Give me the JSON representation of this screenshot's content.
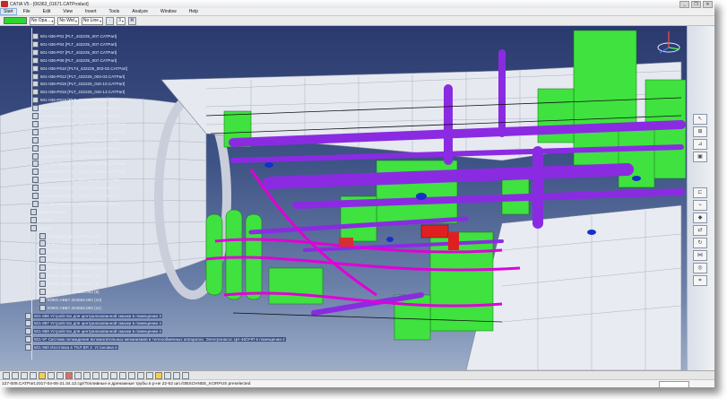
{
  "window": {
    "title": "CATIA V5 - [06363_01671.CATProduct]"
  },
  "window_buttons": [
    "_",
    "❐",
    "✕"
  ],
  "menu": {
    "items": [
      "Start",
      "File",
      "Edit",
      "View",
      "Insert",
      "Tools",
      "Analyze",
      "Window",
      "Help"
    ]
  },
  "toolbar": {
    "combo1": "No Opa...",
    "combo2": "No Wid",
    "combo3": "No Line",
    "combo4": "3",
    "arrow": "▾"
  },
  "tree": {
    "items": [
      "501-036-P01 [PLT_432225_007.CATPart]",
      "501-036-P04 [PLT_432225_007.CATPart]",
      "501-036-P07 [PLT_432225_007.CATPart]",
      "501-036-P09 [PLT_432225_007.CATPart]",
      "501-036-P010 [PLT4_432225_003-02.CATPart]",
      "501-036-P012 [PLT_432225_003-03.CATPart]",
      "501-036-P015 [PLT_432225_016-10.CATPart]",
      "501-036-P016 [PLT_432225_016-13.CATPart]",
      "501-036-P018 [PLT_432225_016.CATPart]",
      "501-036-P019 [PLT_432225_016.CATPart]",
      "501-036-P020 [PLT_432225_016.CATPart]",
      "501-036-P021 [PLT_432225_003-03.CATPart]",
      "501-036-P022 [PLT_432225_003-03.CATPart]",
      "501-036-P023 [PLT_432225_016.CATPart]",
      "501-036-P024 [PLT_432225_016.CATPart]",
      "501-036-P025 [PLT_432225_016.CATPart]",
      "501-036-P026 [PLT_432225_003-03.CATPart]",
      "501-036-P027 [PLT_432225_003-03.CATPart]",
      "501-036-P028 [PLT_432225_016.CATPart]",
      "501-036-P029 [PLT_432225_016.CATPart]",
      "501-036-P030 [PLT_432225_016.CATPart]",
      "501-036-P031 [PLT_432225_016.CATPart]",
      "Документация",
      "Views",
      "Notes",
      "Спецификация 501-959 (2)",
      "ЮЖО.АВБ7.348035.081 (3)",
      "ЮЖО.АВБ7.348035.081 ПЭ (4)",
      "ЮЖО.АВБ7.348035.081 СБ (5)",
      "ЮЖО.АВБ7.348035.081 МЧ (6)",
      "ЮЖО.АВБ7.348035.081 (7)",
      "ЮЖО.АВБ7.342554.092 (8)",
      "ЮЖО.АВБ7.342554.092 (9)",
      "ЮЖО.АВБ7.342554.092 (10)",
      "ЮЖО.АВБ7.342554.092 (11)",
      "501-896 Устройство для централизованной смазки в помещении 3",
      "501-897 Устройство для централизованной смазки в помещении 4",
      "501-959 Устройство для централизованной смазки в помещении 4",
      "501-97 Система охлаждения вспомогательных механизмов в теплообменных аппаратах. Электронасос ЦН-46/3ЧП в помещении 4",
      "501-960 Изготовка в ТЕЛ ВЯ З. Установка в"
    ]
  },
  "status": {
    "text": "127-009.CATPart.2017-04-06-21.34.12.cgr/Топливные и дренажные трубы в р-не 22-62 шп./OBSCHNEE_KORPUS preselected"
  },
  "colors": {
    "green": "#3fe23f",
    "purple": "#8a2be2",
    "magenta": "#e000d8",
    "bg_top": "#2b3a6e",
    "bg_bottom": "#9cadc8"
  }
}
